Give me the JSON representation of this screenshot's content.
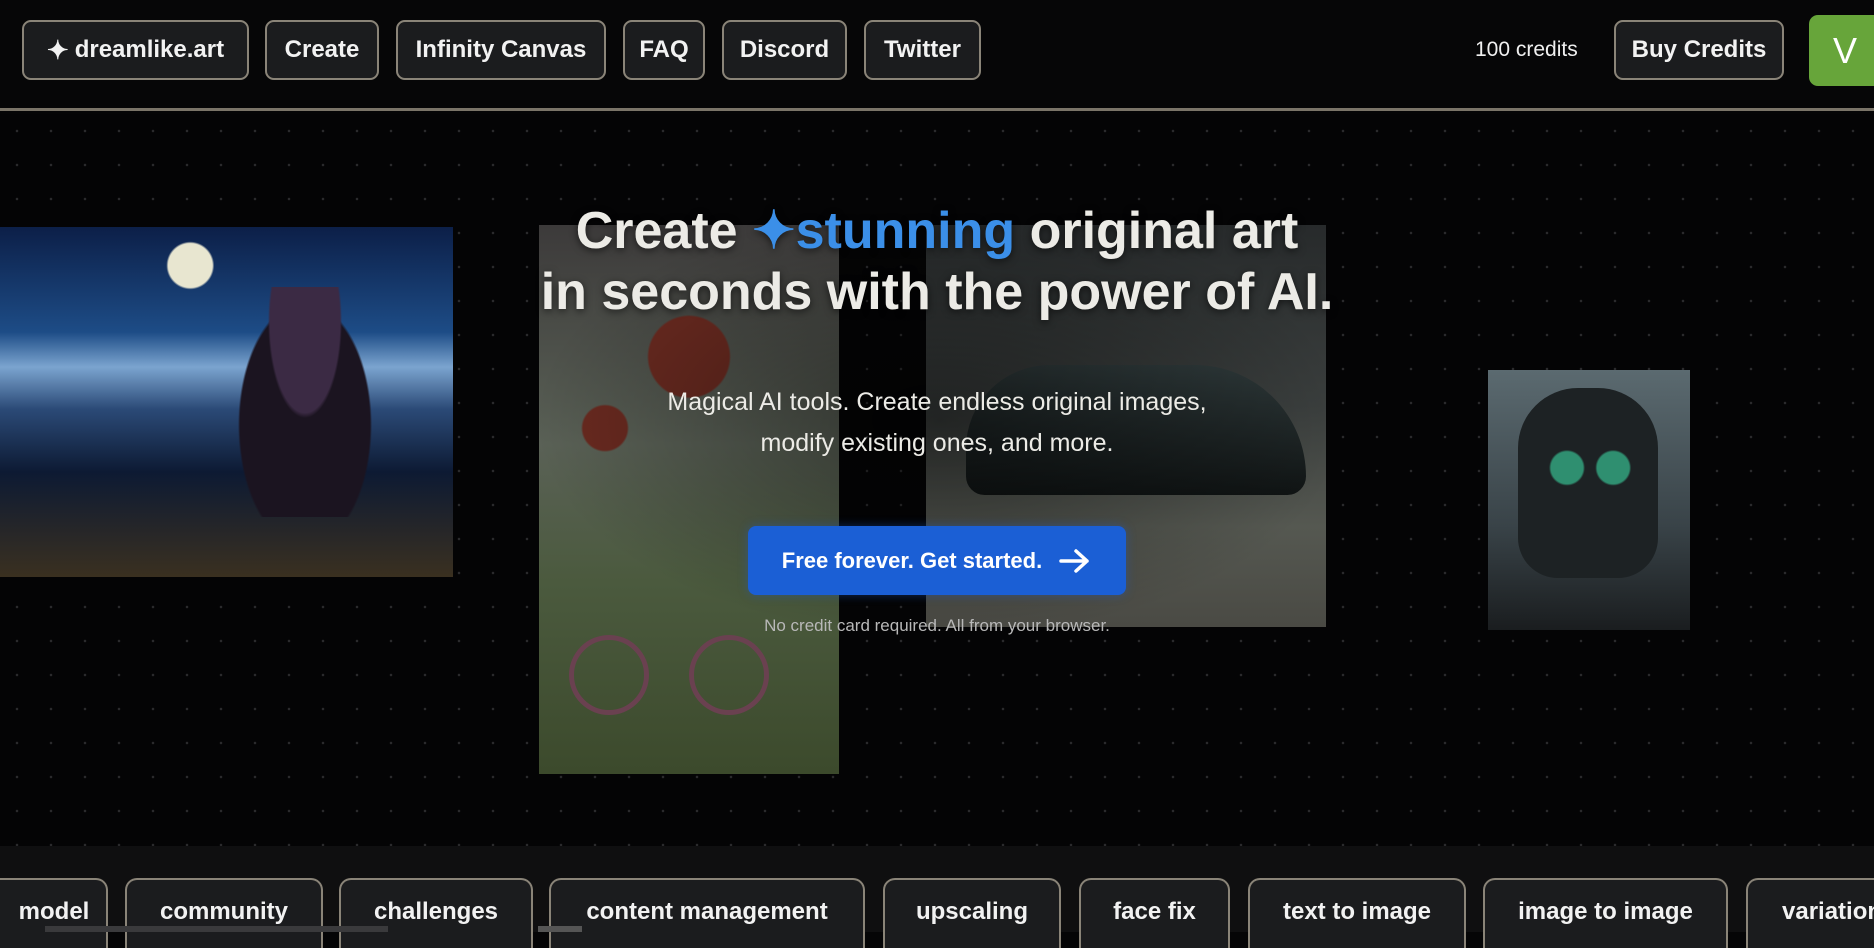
{
  "nav": {
    "logo": "dreamlike.art",
    "logo_icon": "sparkle-icon",
    "items": [
      "Create",
      "Infinity Canvas",
      "FAQ",
      "Discord",
      "Twitter"
    ],
    "credits": "100 credits",
    "buy": "Buy Credits",
    "avatar": "V",
    "avatar_color": "#67a53a"
  },
  "hero": {
    "title_pre": "Create",
    "title_highlight": "stunning",
    "title_post": "original art",
    "title_line2": "in seconds with the power of AI.",
    "accent": "#3b8fe8",
    "subtitle_1": "Magical AI tools. Create endless original images,",
    "subtitle_2": "modify existing ones, and more.",
    "cta": "Free forever. Get started.",
    "cta_icon": "arrow-right-icon",
    "cta_color": "#1b5fd5",
    "note": "No credit card required. All from your browser."
  },
  "tags": [
    "model",
    "community",
    "challenges",
    "content management",
    "upscaling",
    "face fix",
    "text to image",
    "image to image",
    "variation"
  ]
}
